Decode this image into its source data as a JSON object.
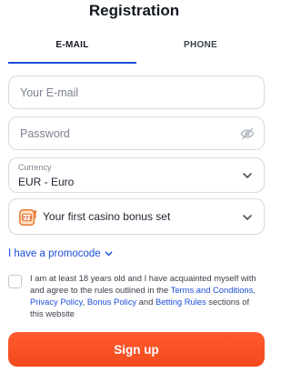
{
  "title": "Registration",
  "tabs": [
    {
      "label": "E-MAIL",
      "active": true
    },
    {
      "label": "PHONE",
      "active": false
    }
  ],
  "form": {
    "email_placeholder": "Your E-mail",
    "password_placeholder": "Password",
    "currency_label": "Currency",
    "currency_value": "EUR - Euro",
    "bonus_value": "Your first casino bonus set"
  },
  "promo_link": "I have a promocode",
  "agreement": {
    "text_1": "I am at least 18 years old and I have acquainted myself with and agree to the rules outlined in the ",
    "terms_link": "Terms and Conditions",
    "sep_1": ", ",
    "privacy_link": "Privacy Policy",
    "sep_2": ", ",
    "bonus_link": "Bonus Policy",
    "sep_3": " and ",
    "betting_link": "Betting Rules",
    "text_2": " sections of this website"
  },
  "signup_label": "Sign up",
  "colors": {
    "accent": "#1d4ed8",
    "button": "#f24a1d",
    "border": "#d6d9e0"
  },
  "icons": {
    "password_toggle": "eye-off-icon",
    "dropdown": "chevron-down-icon",
    "bonus": "slot-machine-icon"
  }
}
